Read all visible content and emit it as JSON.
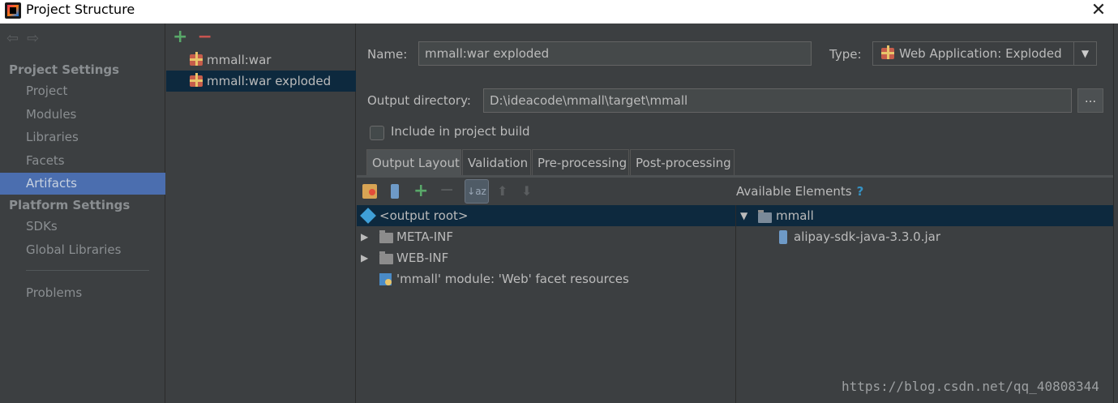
{
  "window": {
    "title": "Project Structure",
    "close_glyph": "✕"
  },
  "nav": {
    "arrows": "⇦⇨",
    "sections": [
      {
        "title": "Project Settings"
      },
      {
        "title": "Platform Settings"
      }
    ],
    "items": [
      {
        "label": "Project"
      },
      {
        "label": "Modules"
      },
      {
        "label": "Libraries"
      },
      {
        "label": "Facets"
      },
      {
        "label": "Artifacts",
        "selected": true
      },
      {
        "label": "SDKs"
      },
      {
        "label": "Global Libraries"
      },
      {
        "label": "Problems"
      }
    ]
  },
  "artifacts": {
    "add": "+",
    "remove": "−",
    "items": [
      {
        "label": "mmall:war"
      },
      {
        "label": "mmall:war exploded",
        "selected": true
      }
    ]
  },
  "form": {
    "name_label": "Name:",
    "name_value": "mmall:war exploded",
    "type_label": "Type:",
    "type_value": "Web Application: Exploded",
    "output_label": "Output directory:",
    "output_value": "D:\\ideacode\\mmall\\target\\mmall",
    "browse": "...",
    "include_label": "Include in project build",
    "include_checked": false
  },
  "tabs": [
    {
      "label": "Output Layout",
      "active": true
    },
    {
      "label": "Validation"
    },
    {
      "label": "Pre-processing"
    },
    {
      "label": "Post-processing"
    }
  ],
  "layout_toolbar": {
    "sort": "↓az",
    "up": "⬆",
    "down": "⬇",
    "plus": "+",
    "minus": "−"
  },
  "output_tree": [
    {
      "label": "<output root>",
      "selected": true
    },
    {
      "label": "META-INF",
      "expander": "▶"
    },
    {
      "label": "WEB-INF",
      "expander": "▶"
    },
    {
      "label": "'mmall' module: 'Web' facet resources"
    }
  ],
  "available": {
    "title": "Available Elements",
    "help": "?",
    "tree": [
      {
        "label": "mmall",
        "expander": "▼",
        "selected": true
      },
      {
        "label": "alipay-sdk-java-3.3.0.jar"
      }
    ]
  },
  "watermark": "https://blog.csdn.net/qq_40808344",
  "colors": {
    "selection": "#0d293e",
    "nav_selected": "#4b6eaf",
    "background": "#3c3f41"
  }
}
